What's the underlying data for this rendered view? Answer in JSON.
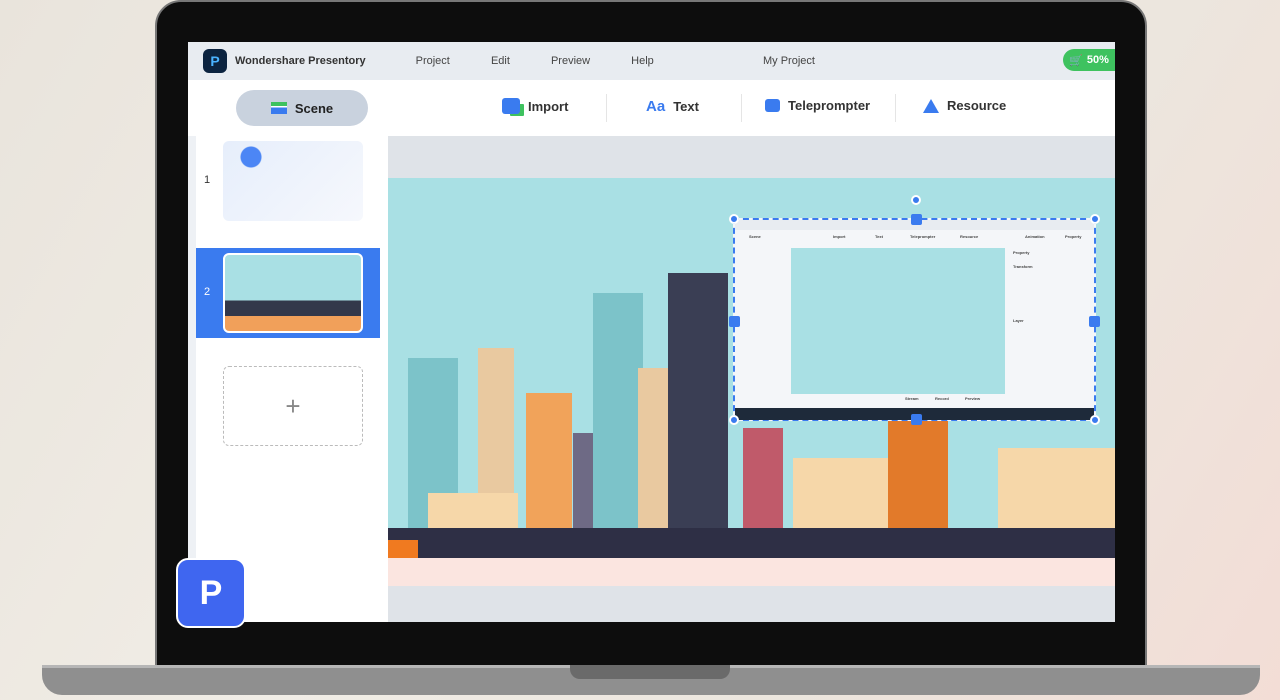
{
  "app": {
    "name": "Wondershare Presentory",
    "project_title": "My Project",
    "cart_label": "50%"
  },
  "menu": [
    "Project",
    "Edit",
    "Preview",
    "Help"
  ],
  "toolbar": {
    "scene": "Scene",
    "import": "Import",
    "text": "Text",
    "teleprompter": "Teleprompter",
    "resource": "Resource"
  },
  "slides": [
    {
      "number": "1"
    },
    {
      "number": "2",
      "selected": true
    }
  ],
  "add_slide": "+",
  "nested": {
    "labels": [
      "Scene",
      "Import",
      "Text",
      "Teleprompter",
      "Resource",
      "Animation",
      "Property"
    ],
    "panel": [
      "Property",
      "Transform",
      "Layer"
    ],
    "bottom": [
      "Stream",
      "Record",
      "Preview"
    ]
  },
  "colors": {
    "accent": "#3a7bef",
    "cart": "#3ec25f",
    "selected_slide": "#3a7bef"
  }
}
